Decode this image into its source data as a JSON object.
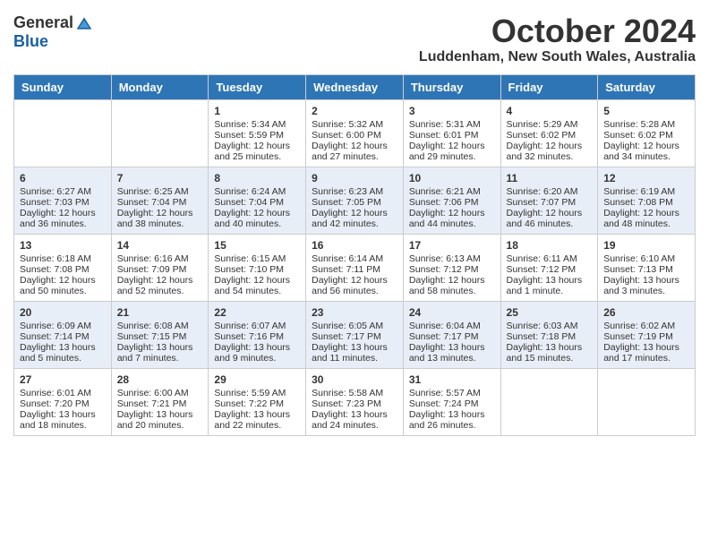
{
  "logo": {
    "general": "General",
    "blue": "Blue"
  },
  "title": "October 2024",
  "location": "Luddenham, New South Wales, Australia",
  "weekdays": [
    "Sunday",
    "Monday",
    "Tuesday",
    "Wednesday",
    "Thursday",
    "Friday",
    "Saturday"
  ],
  "weeks": [
    [
      {
        "day": "",
        "info": ""
      },
      {
        "day": "",
        "info": ""
      },
      {
        "day": "1",
        "info": "Sunrise: 5:34 AM\nSunset: 5:59 PM\nDaylight: 12 hours\nand 25 minutes."
      },
      {
        "day": "2",
        "info": "Sunrise: 5:32 AM\nSunset: 6:00 PM\nDaylight: 12 hours\nand 27 minutes."
      },
      {
        "day": "3",
        "info": "Sunrise: 5:31 AM\nSunset: 6:01 PM\nDaylight: 12 hours\nand 29 minutes."
      },
      {
        "day": "4",
        "info": "Sunrise: 5:29 AM\nSunset: 6:02 PM\nDaylight: 12 hours\nand 32 minutes."
      },
      {
        "day": "5",
        "info": "Sunrise: 5:28 AM\nSunset: 6:02 PM\nDaylight: 12 hours\nand 34 minutes."
      }
    ],
    [
      {
        "day": "6",
        "info": "Sunrise: 6:27 AM\nSunset: 7:03 PM\nDaylight: 12 hours\nand 36 minutes."
      },
      {
        "day": "7",
        "info": "Sunrise: 6:25 AM\nSunset: 7:04 PM\nDaylight: 12 hours\nand 38 minutes."
      },
      {
        "day": "8",
        "info": "Sunrise: 6:24 AM\nSunset: 7:04 PM\nDaylight: 12 hours\nand 40 minutes."
      },
      {
        "day": "9",
        "info": "Sunrise: 6:23 AM\nSunset: 7:05 PM\nDaylight: 12 hours\nand 42 minutes."
      },
      {
        "day": "10",
        "info": "Sunrise: 6:21 AM\nSunset: 7:06 PM\nDaylight: 12 hours\nand 44 minutes."
      },
      {
        "day": "11",
        "info": "Sunrise: 6:20 AM\nSunset: 7:07 PM\nDaylight: 12 hours\nand 46 minutes."
      },
      {
        "day": "12",
        "info": "Sunrise: 6:19 AM\nSunset: 7:08 PM\nDaylight: 12 hours\nand 48 minutes."
      }
    ],
    [
      {
        "day": "13",
        "info": "Sunrise: 6:18 AM\nSunset: 7:08 PM\nDaylight: 12 hours\nand 50 minutes."
      },
      {
        "day": "14",
        "info": "Sunrise: 6:16 AM\nSunset: 7:09 PM\nDaylight: 12 hours\nand 52 minutes."
      },
      {
        "day": "15",
        "info": "Sunrise: 6:15 AM\nSunset: 7:10 PM\nDaylight: 12 hours\nand 54 minutes."
      },
      {
        "day": "16",
        "info": "Sunrise: 6:14 AM\nSunset: 7:11 PM\nDaylight: 12 hours\nand 56 minutes."
      },
      {
        "day": "17",
        "info": "Sunrise: 6:13 AM\nSunset: 7:12 PM\nDaylight: 12 hours\nand 58 minutes."
      },
      {
        "day": "18",
        "info": "Sunrise: 6:11 AM\nSunset: 7:12 PM\nDaylight: 13 hours\nand 1 minute."
      },
      {
        "day": "19",
        "info": "Sunrise: 6:10 AM\nSunset: 7:13 PM\nDaylight: 13 hours\nand 3 minutes."
      }
    ],
    [
      {
        "day": "20",
        "info": "Sunrise: 6:09 AM\nSunset: 7:14 PM\nDaylight: 13 hours\nand 5 minutes."
      },
      {
        "day": "21",
        "info": "Sunrise: 6:08 AM\nSunset: 7:15 PM\nDaylight: 13 hours\nand 7 minutes."
      },
      {
        "day": "22",
        "info": "Sunrise: 6:07 AM\nSunset: 7:16 PM\nDaylight: 13 hours\nand 9 minutes."
      },
      {
        "day": "23",
        "info": "Sunrise: 6:05 AM\nSunset: 7:17 PM\nDaylight: 13 hours\nand 11 minutes."
      },
      {
        "day": "24",
        "info": "Sunrise: 6:04 AM\nSunset: 7:17 PM\nDaylight: 13 hours\nand 13 minutes."
      },
      {
        "day": "25",
        "info": "Sunrise: 6:03 AM\nSunset: 7:18 PM\nDaylight: 13 hours\nand 15 minutes."
      },
      {
        "day": "26",
        "info": "Sunrise: 6:02 AM\nSunset: 7:19 PM\nDaylight: 13 hours\nand 17 minutes."
      }
    ],
    [
      {
        "day": "27",
        "info": "Sunrise: 6:01 AM\nSunset: 7:20 PM\nDaylight: 13 hours\nand 18 minutes."
      },
      {
        "day": "28",
        "info": "Sunrise: 6:00 AM\nSunset: 7:21 PM\nDaylight: 13 hours\nand 20 minutes."
      },
      {
        "day": "29",
        "info": "Sunrise: 5:59 AM\nSunset: 7:22 PM\nDaylight: 13 hours\nand 22 minutes."
      },
      {
        "day": "30",
        "info": "Sunrise: 5:58 AM\nSunset: 7:23 PM\nDaylight: 13 hours\nand 24 minutes."
      },
      {
        "day": "31",
        "info": "Sunrise: 5:57 AM\nSunset: 7:24 PM\nDaylight: 13 hours\nand 26 minutes."
      },
      {
        "day": "",
        "info": ""
      },
      {
        "day": "",
        "info": ""
      }
    ]
  ]
}
